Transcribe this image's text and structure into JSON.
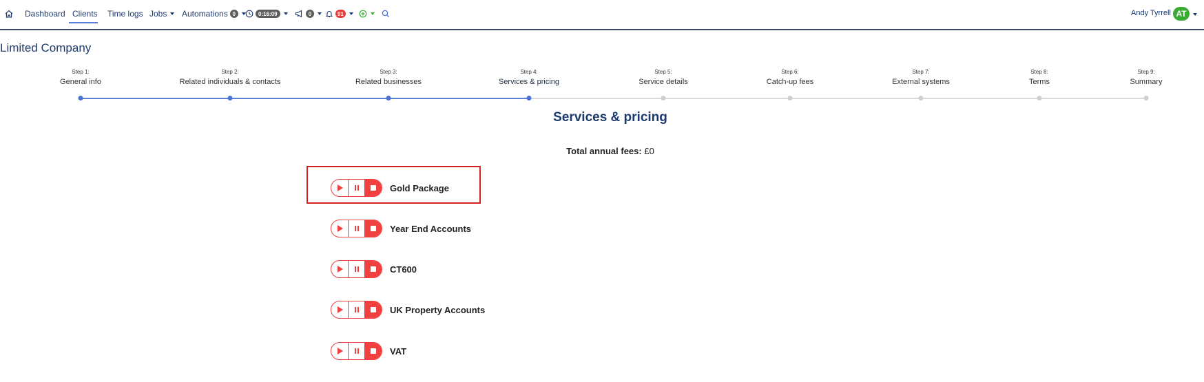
{
  "nav": {
    "dashboard": "Dashboard",
    "clients": "Clients",
    "time_logs": "Time logs",
    "jobs": "Jobs",
    "automations": "Automations",
    "automations_count": "0",
    "timer": "0:16:09",
    "announcements_count": "0",
    "notifications_count": "91",
    "user_name": "Andy Tyrrell",
    "user_initials": "AT"
  },
  "page": {
    "title": "Limited Company"
  },
  "steps": [
    {
      "num": "Step 1:",
      "label": "General info"
    },
    {
      "num": "Step 2:",
      "label": "Related individuals & contacts"
    },
    {
      "num": "Step 3:",
      "label": "Related businesses"
    },
    {
      "num": "Step 4:",
      "label": "Services & pricing"
    },
    {
      "num": "Step 5:",
      "label": "Service details"
    },
    {
      "num": "Step 6:",
      "label": "Catch-up fees"
    },
    {
      "num": "Step 7:",
      "label": "External systems"
    },
    {
      "num": "Step 8:",
      "label": "Terms"
    },
    {
      "num": "Step 9:",
      "label": "Summary"
    }
  ],
  "section": {
    "title": "Services & pricing",
    "total_label": "Total annual fees:",
    "total_value": "£0"
  },
  "services": [
    {
      "name": "Gold Package"
    },
    {
      "name": "Year End Accounts"
    },
    {
      "name": "CT600"
    },
    {
      "name": "UK Property Accounts"
    },
    {
      "name": "VAT"
    }
  ],
  "colors": {
    "accent": "#1d3a6e",
    "progress": "#4a72d8",
    "control_red": "#f04040",
    "avatar_green": "#3aaa35",
    "highlight": "#d42020"
  }
}
